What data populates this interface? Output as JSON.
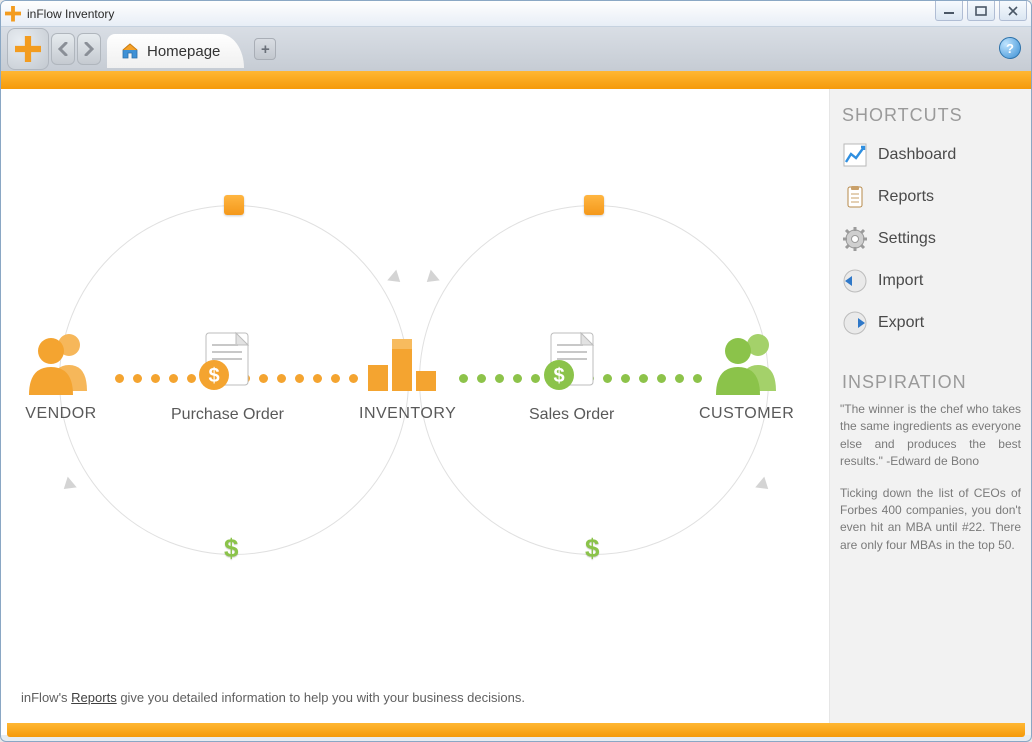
{
  "window": {
    "title": "inFlow Inventory"
  },
  "tab": {
    "label": "Homepage"
  },
  "diagram": {
    "vendor_label": "VENDOR",
    "po_label": "Purchase Order",
    "inventory_label": "INVENTORY",
    "so_label": "Sales Order",
    "customer_label": "CUSTOMER"
  },
  "tip": {
    "prefix": "inFlow's ",
    "link": "Reports",
    "suffix": " give you detailed information to help you with your business decisions."
  },
  "sidebar": {
    "shortcuts_heading": "SHORTCUTS",
    "items": [
      {
        "label": "Dashboard"
      },
      {
        "label": "Reports"
      },
      {
        "label": "Settings"
      },
      {
        "label": "Import"
      },
      {
        "label": "Export"
      }
    ],
    "inspiration_heading": "INSPIRATION",
    "quote": "\"The winner is the chef who takes the same ingredients as everyone else and produces the best results.\" -Edward de Bono",
    "fact": "Ticking down the list of CEOs of Forbes 400 companies, you don't even hit an MBA until #22. There are only four MBAs in the top 50."
  },
  "help": "?"
}
